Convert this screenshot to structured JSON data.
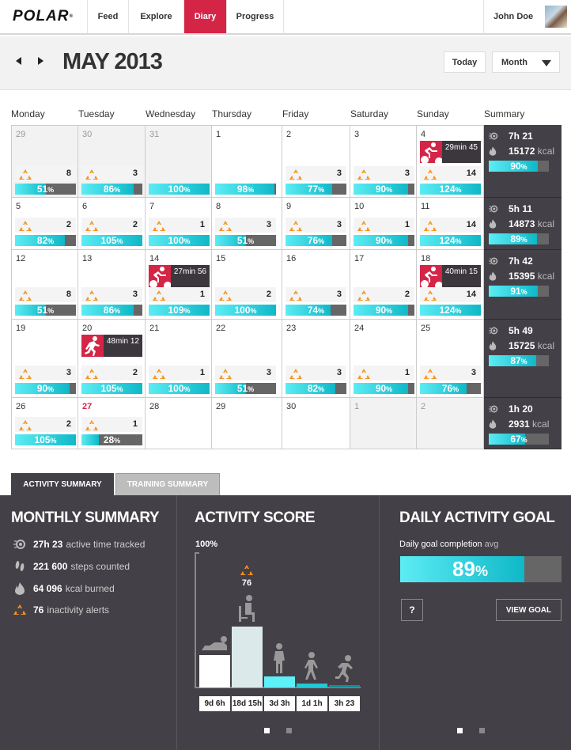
{
  "app": {
    "logo": "POLAR",
    "user_name": "John Doe"
  },
  "nav": [
    {
      "label": "Feed",
      "active": false
    },
    {
      "label": "Explore",
      "active": false
    },
    {
      "label": "Diary",
      "active": true
    },
    {
      "label": "Progress",
      "active": false
    }
  ],
  "header": {
    "title": "MAY 2013",
    "today_label": "Today",
    "view_select": "Month"
  },
  "weekdays": [
    "Monday",
    "Tuesday",
    "Wednesday",
    "Thursday",
    "Friday",
    "Saturday",
    "Sunday",
    "Summary"
  ],
  "weeks": [
    {
      "days": [
        {
          "day": "29",
          "other": true,
          "alerts": 8,
          "goal": 51
        },
        {
          "day": "30",
          "other": true,
          "alerts": 3,
          "goal": 86
        },
        {
          "day": "31",
          "other": true,
          "alerts": null,
          "goal": 100
        },
        {
          "day": "1",
          "alerts": null,
          "goal": 98
        },
        {
          "day": "2",
          "alerts": 3,
          "goal": 77
        },
        {
          "day": "3",
          "alerts": 3,
          "goal": 90
        },
        {
          "day": "4",
          "alerts": 14,
          "goal": 124,
          "training": {
            "sport": "cycling",
            "duration": "29min 45"
          }
        }
      ],
      "summary": {
        "active_time": "7h 21",
        "kcal": "15172",
        "kcal_unit": "kcal",
        "goal": 90
      }
    },
    {
      "days": [
        {
          "day": "5",
          "alerts": 2,
          "goal": 82
        },
        {
          "day": "6",
          "alerts": 2,
          "goal": 105
        },
        {
          "day": "7",
          "alerts": 1,
          "goal": 100
        },
        {
          "day": "8",
          "alerts": 3,
          "goal": 51
        },
        {
          "day": "9",
          "alerts": 3,
          "goal": 76
        },
        {
          "day": "10",
          "alerts": 1,
          "goal": 90
        },
        {
          "day": "11",
          "alerts": 14,
          "goal": 124
        }
      ],
      "summary": {
        "active_time": "5h 11",
        "kcal": "14873",
        "kcal_unit": "kcal",
        "goal": 89
      }
    },
    {
      "days": [
        {
          "day": "12",
          "alerts": 8,
          "goal": 51
        },
        {
          "day": "13",
          "alerts": 3,
          "goal": 86
        },
        {
          "day": "14",
          "alerts": 1,
          "goal": 109,
          "training": {
            "sport": "cycling",
            "duration": "27min 56"
          }
        },
        {
          "day": "15",
          "alerts": 2,
          "goal": 100
        },
        {
          "day": "16",
          "alerts": 3,
          "goal": 74
        },
        {
          "day": "17",
          "alerts": 2,
          "goal": 90
        },
        {
          "day": "18",
          "alerts": 14,
          "goal": 124,
          "training": {
            "sport": "cycling",
            "duration": "40min 15"
          }
        }
      ],
      "summary": {
        "active_time": "7h 42",
        "kcal": "15395",
        "kcal_unit": "kcal",
        "goal": 91
      }
    },
    {
      "days": [
        {
          "day": "19",
          "alerts": 3,
          "goal": 90
        },
        {
          "day": "20",
          "alerts": 2,
          "goal": 105,
          "training": {
            "sport": "running",
            "duration": "48min 12"
          }
        },
        {
          "day": "21",
          "alerts": 1,
          "goal": 100
        },
        {
          "day": "22",
          "alerts": 3,
          "goal": 51
        },
        {
          "day": "23",
          "alerts": 3,
          "goal": 82
        },
        {
          "day": "24",
          "alerts": 1,
          "goal": 90
        },
        {
          "day": "25",
          "alerts": 3,
          "goal": 76
        }
      ],
      "summary": {
        "active_time": "5h 49",
        "kcal": "15725",
        "kcal_unit": "kcal",
        "goal": 87
      }
    },
    {
      "days": [
        {
          "day": "26",
          "alerts": 2,
          "goal": 105
        },
        {
          "day": "27",
          "today": true,
          "alerts": 1,
          "goal": 28
        },
        {
          "day": "28"
        },
        {
          "day": "29"
        },
        {
          "day": "30"
        },
        {
          "day": "1",
          "other": true
        },
        {
          "day": "2",
          "other": true
        }
      ],
      "summary": {
        "active_time": "1h 20",
        "kcal": "2931",
        "kcal_unit": "kcal",
        "goal": 67
      }
    }
  ],
  "bottom_tabs": [
    {
      "label": "ACTIVITY SUMMARY",
      "active": true
    },
    {
      "label": "TRAINING SUMMARY",
      "active": false
    }
  ],
  "monthly_summary": {
    "title": "MONTHLY SUMMARY",
    "stats": [
      {
        "icon": "active-time-icon",
        "value": "27h 23",
        "label": "active time tracked"
      },
      {
        "icon": "steps-icon",
        "value": "221 600",
        "label": "steps counted"
      },
      {
        "icon": "flame-icon",
        "value": "64 096",
        "label": "kcal burned"
      },
      {
        "icon": "inactivity-alert-icon",
        "value": "76",
        "label": "inactivity alerts"
      }
    ]
  },
  "activity_score": {
    "title": "ACTIVITY SCORE",
    "axis_max_label": "100%",
    "inactivity_alerts": "76",
    "chart_data": {
      "type": "bar",
      "title": "ACTIVITY SCORE",
      "ylabel": "",
      "ylim": [
        0,
        100
      ],
      "categories": [
        "resting",
        "sitting",
        "standing",
        "walking",
        "running"
      ],
      "labels": [
        "9d 6h",
        "18d 15h",
        "3d 3h",
        "1d 1h",
        "3h 23"
      ],
      "values": [
        24,
        45,
        8,
        3,
        1
      ],
      "colors": [
        "#ffffff",
        "#dbe9ea",
        "#5ef0f8",
        "#1fcad8",
        "#0e8f9c"
      ]
    }
  },
  "daily_goal": {
    "title": "DAILY ACTIVITY GOAL",
    "subtitle": "Daily goal completion",
    "subtitle_suffix": "avg",
    "value": 89,
    "help_label": "?",
    "view_goal_label": "VIEW GOAL"
  },
  "colors": {
    "accent": "#d42547",
    "goal_fill": "#17c2d0",
    "panel_bg": "#444047"
  }
}
